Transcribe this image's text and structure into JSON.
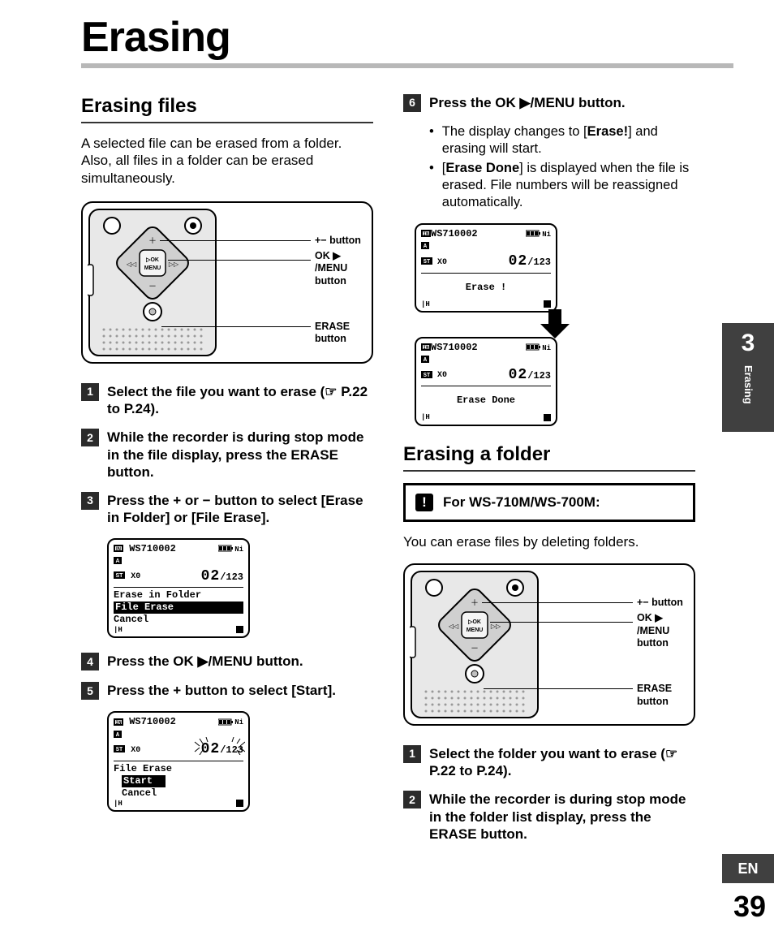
{
  "title": "Erasing",
  "left": {
    "heading": "Erasing files",
    "intro": "A selected file can be erased from a folder. Also, all files in a folder can be erased simultaneously.",
    "fig": {
      "plus_label": "+− button",
      "ok_label": "OK ▶ /MENU button",
      "erase_label": "ERASE button"
    },
    "steps": [
      {
        "n": "1",
        "html": "<span class='bold'>Select the file you want to erase (☞ P.22 to P.24).</span>"
      },
      {
        "n": "2",
        "html": "<span class='bold'>While the recorder is during stop mode in the file display, press the ERASE button.</span>"
      },
      {
        "n": "3",
        "html": "<span class='bold'>Press the + or − button to select [Erase in Folder] or [File Erase].</span>"
      },
      {
        "n": "4",
        "html": "<span class='bold'>Press the OK ▶/MENU button.</span>"
      },
      {
        "n": "5",
        "html": "<span class='bold'>Press the + button to select [Start].</span>"
      }
    ],
    "lcd_menu": {
      "file": "WS710002",
      "counter_big": "02",
      "counter_small": "/123",
      "items": [
        "Erase in Folder",
        "File Erase",
        "Cancel"
      ],
      "selected_index": 1
    },
    "lcd_start": {
      "file": "WS710002",
      "counter_big": "02",
      "counter_small": "/123",
      "title": "File Erase",
      "items": [
        "Start",
        "Cancel"
      ],
      "selected_index": 0
    }
  },
  "right": {
    "step6": {
      "n": "6",
      "html": "<span class='bold'>Press the OK ▶/MENU button.</span>"
    },
    "bullets": [
      "The display changes to [<b>Erase!</b>] and erasing will start.",
      "[<b>Erase Done</b>] is displayed when the file is erased. File numbers will be reassigned automatically."
    ],
    "lcd_erase": {
      "file": "WS710002",
      "counter_big": "02",
      "counter_small": "/123",
      "msg": "Erase !"
    },
    "lcd_done": {
      "file": "WS710002",
      "counter_big": "02",
      "counter_small": "/123",
      "msg": "Erase Done"
    },
    "heading2": "Erasing a folder",
    "important": "For WS-710M/WS-700M:",
    "important_text": "You can erase files by deleting folders.",
    "fig2": {
      "plus_label": "+− button",
      "ok_label": "OK ▶ /MENU button",
      "erase_label": "ERASE button"
    },
    "steps2": [
      {
        "n": "1",
        "html": "<span class='bold'>Select the folder you want to erase (☞ P.22 to P.24).</span>"
      },
      {
        "n": "2",
        "html": "<span class='bold'>While the recorder is during stop mode in the folder list display, press the ERASE button.</span>"
      }
    ]
  },
  "side": {
    "chapter_num": "3",
    "chapter_label": "Erasing",
    "lang": "EN",
    "page": "39"
  }
}
